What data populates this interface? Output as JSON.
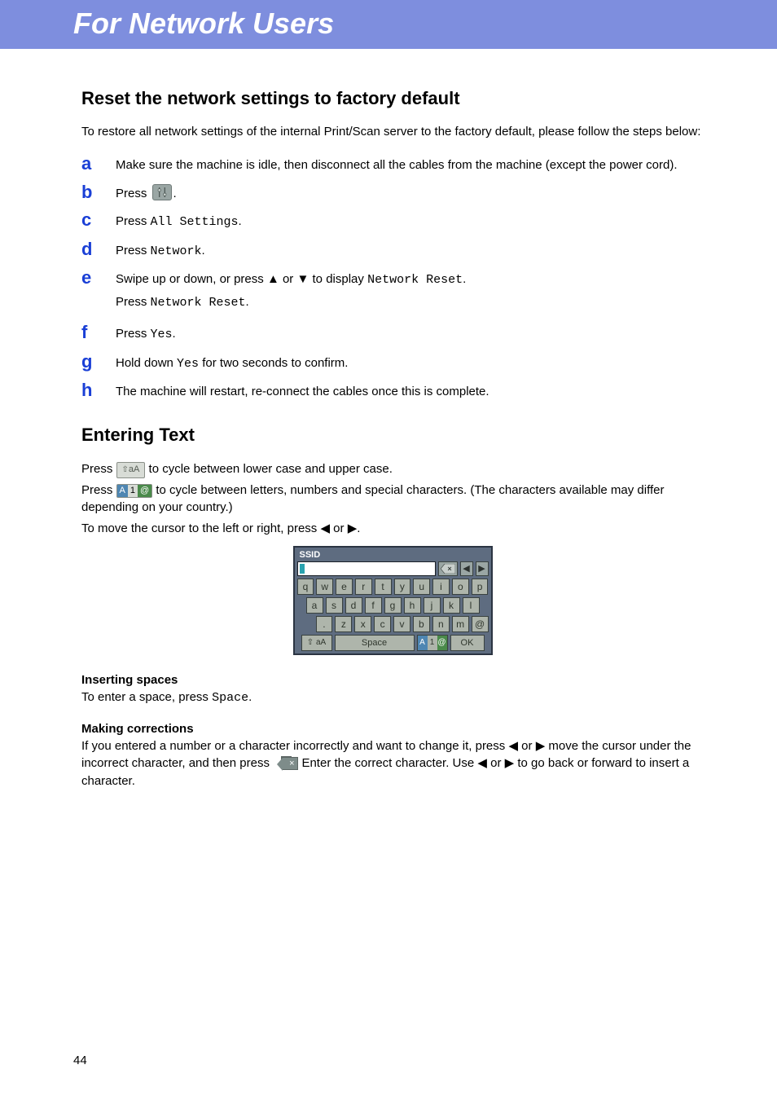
{
  "banner": {
    "title": "For Network Users"
  },
  "reset_section": {
    "title": "Reset the network settings to factory default",
    "intro": "To restore all network settings of the internal Print/Scan server to the factory default, please follow the steps below:",
    "steps": {
      "a": {
        "letter": "a",
        "text": "Make sure the machine is idle, then disconnect all the cables from the machine (except the power cord)."
      },
      "b": {
        "letter": "b",
        "press": "Press ",
        "period": "."
      },
      "c": {
        "letter": "c",
        "press": "Press ",
        "cmd": "All Settings",
        "period": "."
      },
      "d": {
        "letter": "d",
        "press": "Press ",
        "cmd": "Network",
        "period": "."
      },
      "e": {
        "letter": "e",
        "line1_pre": "Swipe up or down, or press ",
        "up": "▲",
        "or": " or ",
        "down": "▼",
        "line1_mid": " to display ",
        "cmd1": "Network Reset",
        "period1": ".",
        "line2_press": "Press ",
        "cmd2": "Network Reset",
        "period2": "."
      },
      "f": {
        "letter": "f",
        "press": "Press ",
        "cmd": "Yes",
        "period": "."
      },
      "g": {
        "letter": "g",
        "pre": "Hold down ",
        "cmd": "Yes",
        "post": " for two seconds to confirm."
      },
      "h": {
        "letter": "h",
        "text": "The machine will restart, re-connect the cables once this is complete."
      }
    }
  },
  "entering_section": {
    "title": "Entering Text",
    "p1_pre": "Press ",
    "p1_post": " to cycle between lower case and upper case.",
    "shift_label_arrow": "⇧",
    "shift_label_text": "aA",
    "p2_pre": "Press ",
    "p2_post": " to cycle between letters, numbers and special characters. (The characters available may differ depending on your country.)",
    "mode_A": "A",
    "mode_1": "1",
    "mode_at": "@",
    "p3_pre": "To move the cursor to the left or right, press ",
    "tri_left": "◀",
    "or": " or ",
    "tri_right": "▶",
    "p3_post": ".",
    "inserting_title": "Inserting spaces",
    "inserting_pre": "To enter a space, press ",
    "inserting_cmd": "Space",
    "inserting_post": ".",
    "corrections_title": "Making corrections",
    "corr_pre": "If you entered a number or a character incorrectly and want to change it, press ",
    "corr_mid1": " move the cursor under the incorrect character, and then press ",
    "corr_mid2": ". Enter the correct character. Use ",
    "corr_post": " to go back or forward to insert a character.",
    "bksp_label": "×"
  },
  "keyboard": {
    "title": "SSID",
    "bksp": "×",
    "left": "◀",
    "right": "▶",
    "row0": [
      "q",
      "w",
      "e",
      "r",
      "t",
      "y",
      "u",
      "i",
      "o",
      "p"
    ],
    "row1": [
      "a",
      "s",
      "d",
      "f",
      "g",
      "h",
      "j",
      "k",
      "l"
    ],
    "row2": [
      ".",
      "z",
      "x",
      "c",
      "v",
      "b",
      "n",
      "m",
      "@"
    ],
    "shift_arrow": "⇧",
    "shift_text": "aA",
    "space": "Space",
    "mode_A": "A",
    "mode_1": "1",
    "mode_at": "@",
    "ok": "OK"
  },
  "page_number": "44"
}
